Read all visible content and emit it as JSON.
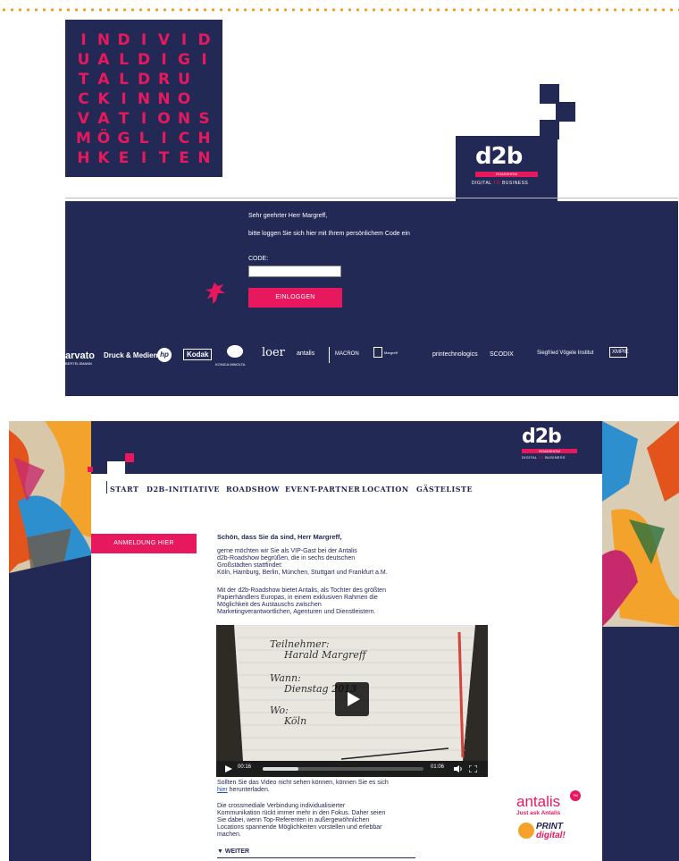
{
  "letter_grid": [
    [
      "I",
      "N",
      "D",
      "I",
      "V",
      "I",
      "D"
    ],
    [
      "U",
      "A",
      "L",
      "D",
      "I",
      "G",
      "I"
    ],
    [
      "T",
      "A",
      "L",
      "D",
      "R",
      "U"
    ],
    [
      "C",
      "K",
      "I",
      "N",
      "N",
      "O"
    ],
    [
      "V",
      "A",
      "T",
      "I",
      "O",
      "N",
      "S"
    ],
    [
      "M",
      "Ö",
      "G",
      "L",
      "I",
      "C",
      "H"
    ],
    [
      "H",
      "K",
      "E",
      "I",
      "T",
      "E",
      "N"
    ]
  ],
  "brand": {
    "logo_main": "d2b",
    "logo_sub": "ROADSHOW",
    "logo_tag_a": "DIGITAL",
    "logo_tag_to": "TO",
    "logo_tag_b": "BUSINESS"
  },
  "login": {
    "greeting": "Sehr geehrter Herr Margreff,",
    "instruction": "bitte loggen Sie sich hier mit Ihrem persönlichem Code ein",
    "code_label": "CODE:",
    "code_value": "",
    "button": "EINLOGGEN"
  },
  "sponsors": [
    "arvato",
    "Druck & Medien",
    "hp",
    "Kodak",
    "KONICA MINOLTA",
    "loer",
    "antalis",
    "MACRON",
    "Margreff",
    "printechnologics",
    "SCODIX",
    "Siegfried Vögele Institut",
    "XMPIE"
  ],
  "sponsor_subs": {
    "arvato": "BERTELSMANN"
  },
  "nav": [
    "START",
    "D2B-INITIATIVE",
    "ROADSHOW",
    "EVENT-PARTNER",
    "LOCATION",
    "GÄSTELISTE"
  ],
  "sidebar": {
    "register_button": "ANMELDUNG HIER"
  },
  "content": {
    "headline": "Schön, dass Sie da sind, Herr Margreff,",
    "p1": [
      "gerne möchten wir Sie als VIP-Gast bei der Antalis",
      "d2b-Roadshow begrüßen, die in sechs deutschen",
      "Großstädten stattfindet:",
      "Köln, Hamburg, Berlin, München, Stuttgart und Frankfurt a.M."
    ],
    "p2": [
      "Mit der d2b-Roadshow bietet Antalis, als Tochter des größten",
      "Papierhändlers Europas, in einem exklusiven Rahmen die",
      "Möglichkeit des Austauschs zwischen",
      "Marketingverantwortlichen, Agenturen und Dienstleistern."
    ],
    "video_note_a": "Sollten Sie das Video nicht sehen können, können Sie es sich",
    "video_note_link": "hier",
    "video_note_b": " herunterladen.",
    "p3": [
      "Die crossmediale Verbindung individualisierter",
      "Kommunikation rückt immer mehr in den Fokus. Daher seien",
      "Sie dabei, wenn Top-Referenten in außergewöhnlichen",
      "Locations spannende Möglichkeiten vorstellen und erlebbar",
      "machen."
    ],
    "more": "WEITER"
  },
  "video": {
    "note_lines": [
      "Teilnehmer:",
      "Harald Margreff",
      "Wann:",
      "Dienstag 2013",
      "Wo:",
      "Köln"
    ],
    "time_current": "00:16",
    "time_total": "01:06",
    "progress": 0.22
  },
  "partners": {
    "antalis": "antalis",
    "antalis_tm": "TM",
    "antalis_tag": "Just ask Antalis",
    "print": "PRINT",
    "digital": "digital!"
  }
}
